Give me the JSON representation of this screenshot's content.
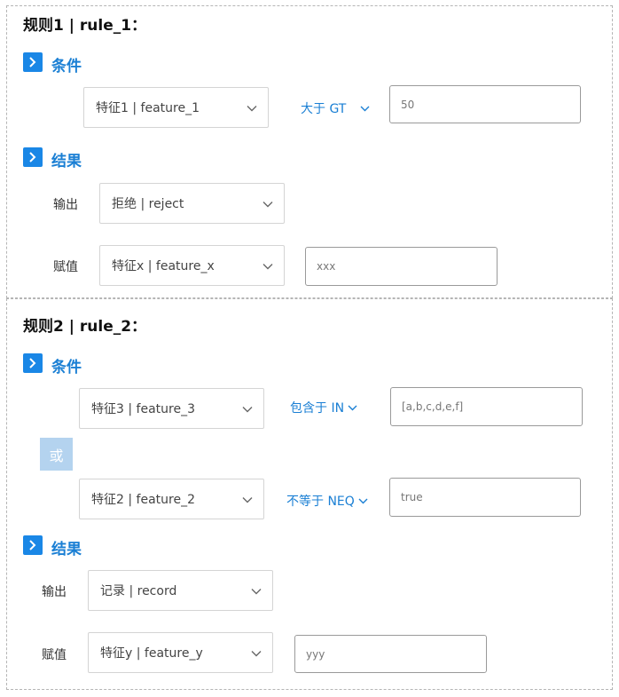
{
  "rule1": {
    "title": "规则1 | rule_1：",
    "condition_label": "条件",
    "conditions": [
      {
        "feature": "特征1 | feature_1",
        "operator": "大于 GT",
        "value": "50"
      }
    ],
    "result_label": "结果",
    "output_label": "输出",
    "output_value": "拒绝 | reject",
    "assign_label": "赋值",
    "assign_feature": "特征x | feature_x",
    "assign_value": "xxx"
  },
  "rule2": {
    "title": "规则2 | rule_2：",
    "condition_label": "条件",
    "conditions": [
      {
        "feature": "特征3 | feature_3",
        "operator": "包含于 IN",
        "value": "[a,b,c,d,e,f]"
      },
      {
        "feature": "特征2 | feature_2",
        "operator": "不等于 NEQ",
        "value": "true"
      }
    ],
    "or_label": "或",
    "result_label": "结果",
    "output_label": "输出",
    "output_value": "记录 | record",
    "assign_label": "赋值",
    "assign_feature": "特征y | feature_y",
    "assign_value": "yyy"
  },
  "colors": {
    "accent": "#1a87e6",
    "accent_text": "#1a7fd4",
    "or_badge": "#b4d3ef",
    "border": "#d4d4d4"
  },
  "icons": {
    "section": "chevron-right-icon",
    "dropdown": "chevron-down-icon"
  }
}
